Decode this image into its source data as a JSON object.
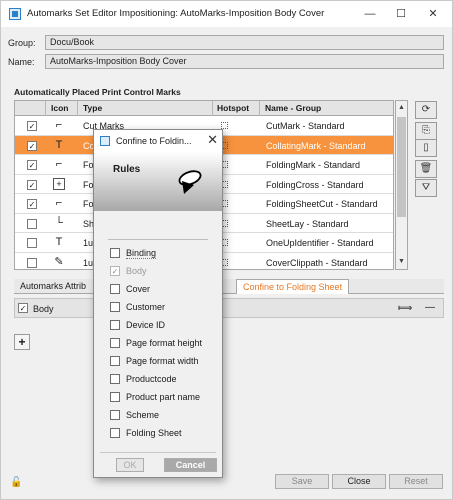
{
  "window": {
    "title": "Automarks Set Editor Impositioning: AutoMarks-Imposition Body Cover",
    "controls": [
      "—",
      "☐",
      "✕"
    ]
  },
  "form": {
    "group_label": "Group:",
    "group_value": "Docu/Book",
    "name_label": "Name:",
    "name_value": "AutoMarks-Imposition Body Cover"
  },
  "marks_section": {
    "title": "Automatically Placed Print Control Marks",
    "columns": [
      "Icon",
      "Type",
      "Hotspot",
      "Name - Group"
    ],
    "rows": [
      {
        "checked": "✓",
        "icon": "⌐",
        "type": "Cut Marks",
        "name": "CutMark - Standard"
      },
      {
        "checked": "✓",
        "icon": "T",
        "type": "Co",
        "name": "CollatingMark - Standard"
      },
      {
        "checked": "✓",
        "icon": "⌐",
        "type": "Fo",
        "name": "FoldingMark - Standard"
      },
      {
        "checked": "✓",
        "icon": "+",
        "type": "Fo",
        "name": "FoldingCross - Standard"
      },
      {
        "checked": "✓",
        "icon": "⌐",
        "type": "Fo",
        "name": "FoldingSheetCut - Standard"
      },
      {
        "checked": "",
        "icon": "└",
        "type": "Sh",
        "name": "SheetLay - Standard"
      },
      {
        "checked": "",
        "icon": "T",
        "type": "1u",
        "name": "OneUpIdentifier - Standard"
      },
      {
        "checked": "",
        "icon": "✎",
        "type": "1u",
        "name": "CoverClippath - Standard"
      }
    ],
    "side_buttons": [
      "⟳",
      "⎘",
      "▯",
      "🗑",
      "⛛"
    ]
  },
  "tabs": {
    "items": [
      "Automarks Attrib",
      "Confine to Folding Sheet"
    ]
  },
  "body_row": {
    "checked": "✓",
    "label": "Body",
    "handle_glyph": "⟾",
    "remove_glyph": "—"
  },
  "add_button": "+",
  "footer": {
    "save": "Save",
    "close": "Close",
    "reset": "Reset"
  },
  "dialog": {
    "title": "Confine to Foldin...",
    "close_glyph": "✕",
    "heading": "Rules",
    "rules": [
      {
        "label": "Binding",
        "checked": "",
        "disabled": false
      },
      {
        "label": "Body",
        "checked": "✓",
        "disabled": true
      },
      {
        "label": "Cover",
        "checked": "",
        "disabled": false
      },
      {
        "label": "Customer",
        "checked": "",
        "disabled": false
      },
      {
        "label": "Device ID",
        "checked": "",
        "disabled": false
      },
      {
        "label": "Page format height",
        "checked": "",
        "disabled": false
      },
      {
        "label": "Page format width",
        "checked": "",
        "disabled": false
      },
      {
        "label": "Productcode",
        "checked": "",
        "disabled": false
      },
      {
        "label": "Product part name",
        "checked": "",
        "disabled": false
      },
      {
        "label": "Scheme",
        "checked": "",
        "disabled": false
      },
      {
        "label": "Folding Sheet",
        "checked": "",
        "disabled": false
      }
    ],
    "ok": "OK",
    "cancel": "Cancel"
  },
  "colors": {
    "accent": "#f7933e",
    "tab_active_text": "#e87722",
    "window_bg": "#f0f0f0"
  }
}
